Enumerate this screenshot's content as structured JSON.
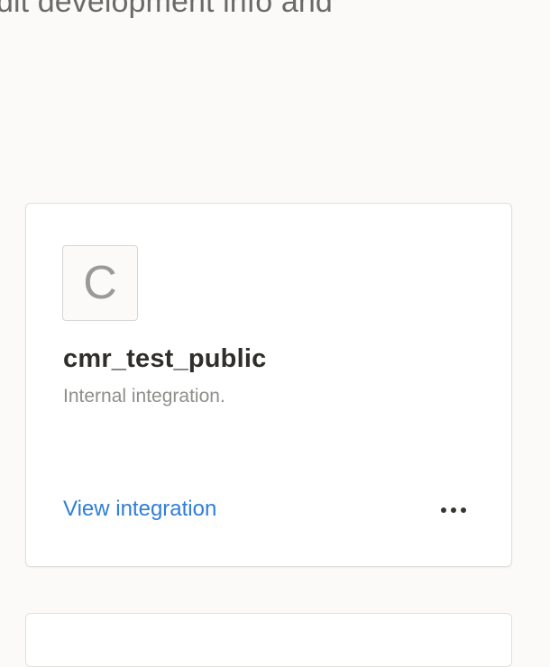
{
  "page": {
    "intro_text": "dit development info and"
  },
  "integration_card": {
    "avatar_letter": "C",
    "name": "cmr_test_public",
    "description": "Internal integration.",
    "view_link_label": "View integration",
    "more_icon": "more-horizontal-icon"
  },
  "colors": {
    "background": "#fbfaf9",
    "link": "#2f7ed8",
    "title_text": "#2f2e2a",
    "muted_text": "#8f8e8a"
  }
}
